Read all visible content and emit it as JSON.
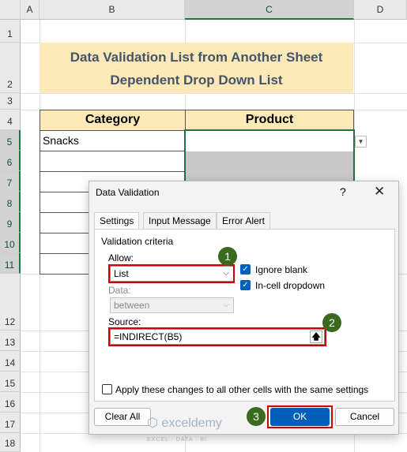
{
  "sheet": {
    "columns": [
      "A",
      "B",
      "C",
      "D"
    ],
    "rows": [
      "1",
      "2",
      "3",
      "4",
      "5",
      "6",
      "7",
      "8",
      "9",
      "10",
      "11",
      "12",
      "13",
      "14",
      "15",
      "16",
      "17",
      "18"
    ],
    "title_line1": "Data Validation List from Another Sheet",
    "title_line2": "Dependent Drop Down List",
    "header_category": "Category",
    "header_product": "Product",
    "b5_value": "Snacks",
    "dropdown_arrow": "chevron-down-icon"
  },
  "dialog": {
    "title": "Data Validation",
    "help": "?",
    "close": "✕",
    "tabs": [
      "Settings",
      "Input Message",
      "Error Alert"
    ],
    "group_label": "Validation criteria",
    "allow_label": "Allow:",
    "allow_value": "List",
    "ignore_blank": "Ignore blank",
    "in_cell_dropdown": "In-cell dropdown",
    "data_label": "Data:",
    "data_value": "between",
    "source_label": "Source:",
    "source_value": "=INDIRECT(B5)",
    "apply_all": "Apply these changes to all other cells with the same settings",
    "clear_all": "Clear All",
    "ok": "OK",
    "cancel": "Cancel",
    "ignore_blank_checked": true,
    "in_cell_dropdown_checked": true,
    "apply_all_checked": false
  },
  "annotations": {
    "badge1": "1",
    "badge2": "2",
    "badge3": "3",
    "highlight_color": "#d00000"
  },
  "watermark": {
    "name": "exceldemy",
    "tagline": "EXCEL · DATA · BI"
  }
}
